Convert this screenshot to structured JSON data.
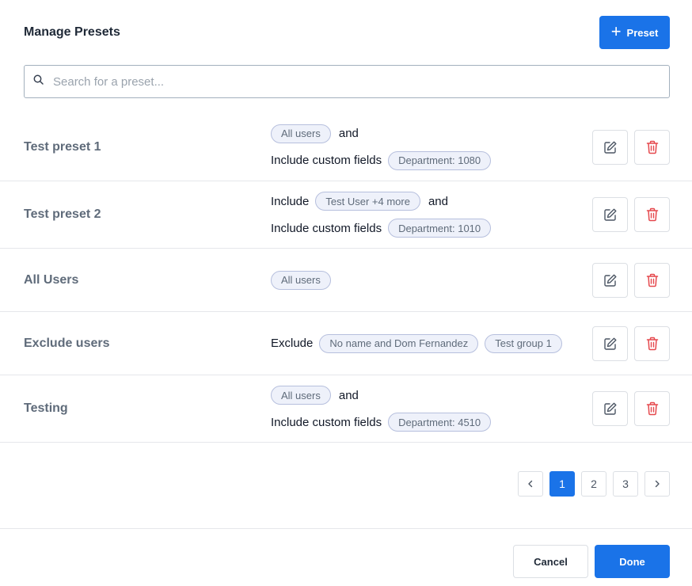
{
  "header": {
    "title": "Manage Presets",
    "add_label": "Preset",
    "add_icon": "plus-icon"
  },
  "search": {
    "placeholder": "Search for a preset...",
    "value": ""
  },
  "presets": [
    {
      "name": "Test preset 1",
      "lines": [
        {
          "prefix": "",
          "chips": [
            "All users"
          ],
          "suffix": "and"
        },
        {
          "prefix": "Include custom fields",
          "chips": [
            "Department: 1080"
          ],
          "suffix": ""
        }
      ]
    },
    {
      "name": "Test preset 2",
      "lines": [
        {
          "prefix": "Include",
          "chips": [
            "Test User +4 more"
          ],
          "suffix": "and"
        },
        {
          "prefix": "Include custom fields",
          "chips": [
            "Department: 1010"
          ],
          "suffix": ""
        }
      ]
    },
    {
      "name": "All Users",
      "lines": [
        {
          "prefix": "",
          "chips": [
            "All users"
          ],
          "suffix": ""
        }
      ]
    },
    {
      "name": "Exclude users",
      "lines": [
        {
          "prefix": "Exclude",
          "chips": [
            "No name and Dom Fernandez",
            "Test group 1"
          ],
          "suffix": ""
        }
      ]
    },
    {
      "name": "Testing",
      "lines": [
        {
          "prefix": "",
          "chips": [
            "All users"
          ],
          "suffix": "and"
        },
        {
          "prefix": "Include custom fields",
          "chips": [
            "Department: 4510"
          ],
          "suffix": ""
        }
      ]
    }
  ],
  "pagination": {
    "pages": [
      "1",
      "2",
      "3"
    ],
    "current": "1",
    "prev_icon": "chevron-left-icon",
    "next_icon": "chevron-right-icon"
  },
  "footer": {
    "cancel_label": "Cancel",
    "done_label": "Done"
  },
  "colors": {
    "primary": "#1a73e8",
    "delete": "#e5484d",
    "chip_bg": "#eef1fa",
    "chip_border": "#b6bfdd"
  }
}
